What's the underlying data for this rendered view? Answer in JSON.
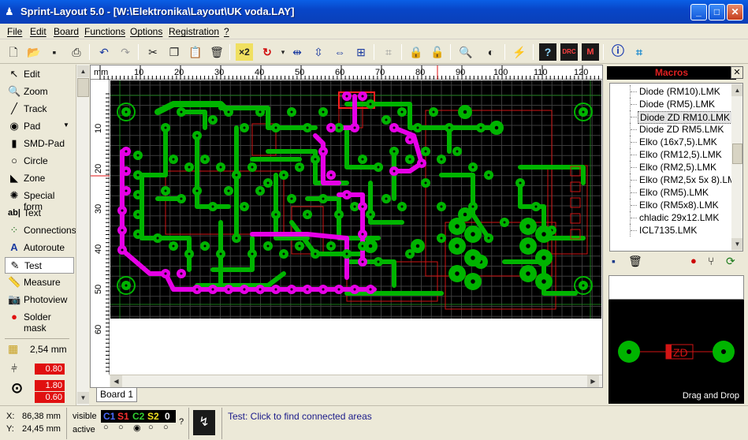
{
  "window": {
    "title": "Sprint-Layout 5.0 - [W:\\Elektronika\\Layout\\UK voda.LAY]",
    "minimize": "_",
    "maximize": "□",
    "close": "✕"
  },
  "menu": [
    "File",
    "Edit",
    "Board",
    "Functions",
    "Options",
    "Registration",
    "?"
  ],
  "toolbar": {
    "icons": [
      "new-icon",
      "open-icon",
      "save-icon",
      "print-icon",
      "undo-icon",
      "redo-icon",
      "cut-icon",
      "copy-icon",
      "paste-icon",
      "delete-icon",
      "multiply-icon",
      "rotate-icon",
      "mirror-h-icon",
      "mirror-v-icon",
      "align-icon",
      "group-icon",
      "ungroup-icon",
      "lock-icon",
      "unlock-icon",
      "zoom-icon",
      "contrast-icon",
      "autoroute-icon",
      "help-icon",
      "drc-icon",
      "macro-icon",
      "info-icon",
      "crop-icon"
    ],
    "multiply_label": "×2"
  },
  "tools": [
    {
      "icon": "arrow-icon",
      "label": "Edit"
    },
    {
      "icon": "magnifier-icon",
      "label": "Zoom"
    },
    {
      "icon": "track-icon",
      "label": "Track"
    },
    {
      "icon": "pad-icon",
      "label": "Pad"
    },
    {
      "icon": "smd-pad-icon",
      "label": "SMD-Pad"
    },
    {
      "icon": "circle-icon",
      "label": "Circle"
    },
    {
      "icon": "zone-icon",
      "label": "Zone"
    },
    {
      "icon": "special-form-icon",
      "label": "Special form"
    },
    {
      "icon": "text-icon",
      "label": "Text"
    },
    {
      "icon": "connections-icon",
      "label": "Connections"
    },
    {
      "icon": "autoroute-icon",
      "label": "Autoroute"
    },
    {
      "icon": "test-icon",
      "label": "Test"
    },
    {
      "icon": "measure-icon",
      "label": "Measure"
    },
    {
      "icon": "photoview-icon",
      "label": "Photoview"
    },
    {
      "icon": "solder-mask-icon",
      "label": "Solder mask"
    }
  ],
  "grid": {
    "value": "2,54 mm"
  },
  "track_width": "0.80",
  "pad_outer": "1.80",
  "pad_inner": "0.60",
  "ruler": {
    "unit": "mm",
    "top": [
      "10",
      "20",
      "30",
      "40",
      "50",
      "60",
      "70",
      "80",
      "90",
      "100",
      "110",
      "120"
    ],
    "left": [
      "10",
      "20",
      "30",
      "40",
      "50",
      "60"
    ]
  },
  "tab": "Board 1",
  "macros": {
    "title": "Macros",
    "items": [
      "Diode (RM10).LMK",
      "Diode (RM5).LMK",
      "Diode ZD RM10.LMK",
      "Diode ZD RM5.LMK",
      "Elko (16x7,5).LMK",
      "Elko (RM12,5).LMK",
      "Elko (RM2,5).LMK",
      "Elko (RM2,5x 5x 8).LMK",
      "Elko (RM5).LMK",
      "Elko (RM5x8).LMK",
      "chladic 29x12.LMK",
      "ICL7135.LMK"
    ],
    "selected_index": 2,
    "preview_label": "ZD",
    "drag_drop": "Drag and Drop"
  },
  "status": {
    "x_label": "X:",
    "x": "86,38 mm",
    "y_label": "Y:",
    "y": "24,45 mm",
    "visible": "visible",
    "active": "active",
    "layers": [
      "C1",
      "S1",
      "C2",
      "S2",
      "0"
    ],
    "question": "?",
    "message": "Test: Click to find connected areas"
  },
  "colors": {
    "board": "#000000",
    "grid": "#4a4a4a",
    "copper": "#00b400",
    "highlight": "#e600e6",
    "silk": "#d21414",
    "window_bg": "#ece9d8"
  }
}
